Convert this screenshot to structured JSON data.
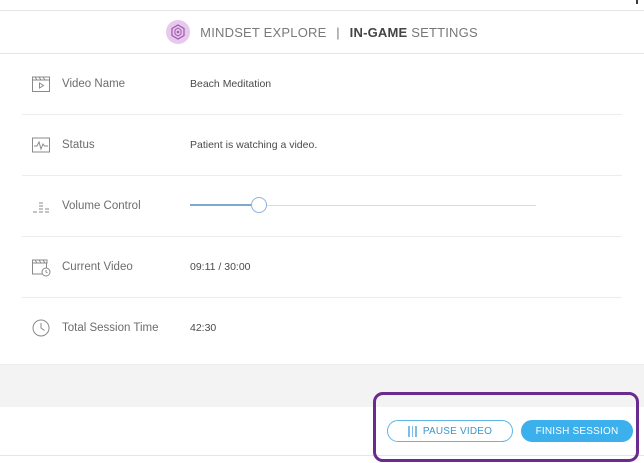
{
  "header": {
    "brand": "MINDSET EXPLORE",
    "separator": "|",
    "title_bold": "IN-GAME",
    "title_light": " SETTINGS"
  },
  "rows": [
    {
      "label": "Video Name",
      "value": "Beach Meditation",
      "icon": "clapperboard-play-icon"
    },
    {
      "label": "Status",
      "value": "Patient is watching a video.",
      "icon": "monitor-pulse-icon"
    },
    {
      "label": "Volume Control",
      "icon": "volume-bars-icon",
      "volume_fraction": 0.2
    },
    {
      "label": "Current Video",
      "value": "09:11 / 30:00",
      "icon": "clapperboard-clock-icon"
    },
    {
      "label": "Total Session Time",
      "value": "42:30",
      "icon": "clock-icon"
    }
  ],
  "footer": {
    "pause_label": "PAUSE VIDEO",
    "finish_label": "FINISH SESSION"
  },
  "colors": {
    "accent": "#3bb0ec",
    "highlight": "#6a2a8e",
    "logo_bg": "#e9c8ef"
  }
}
